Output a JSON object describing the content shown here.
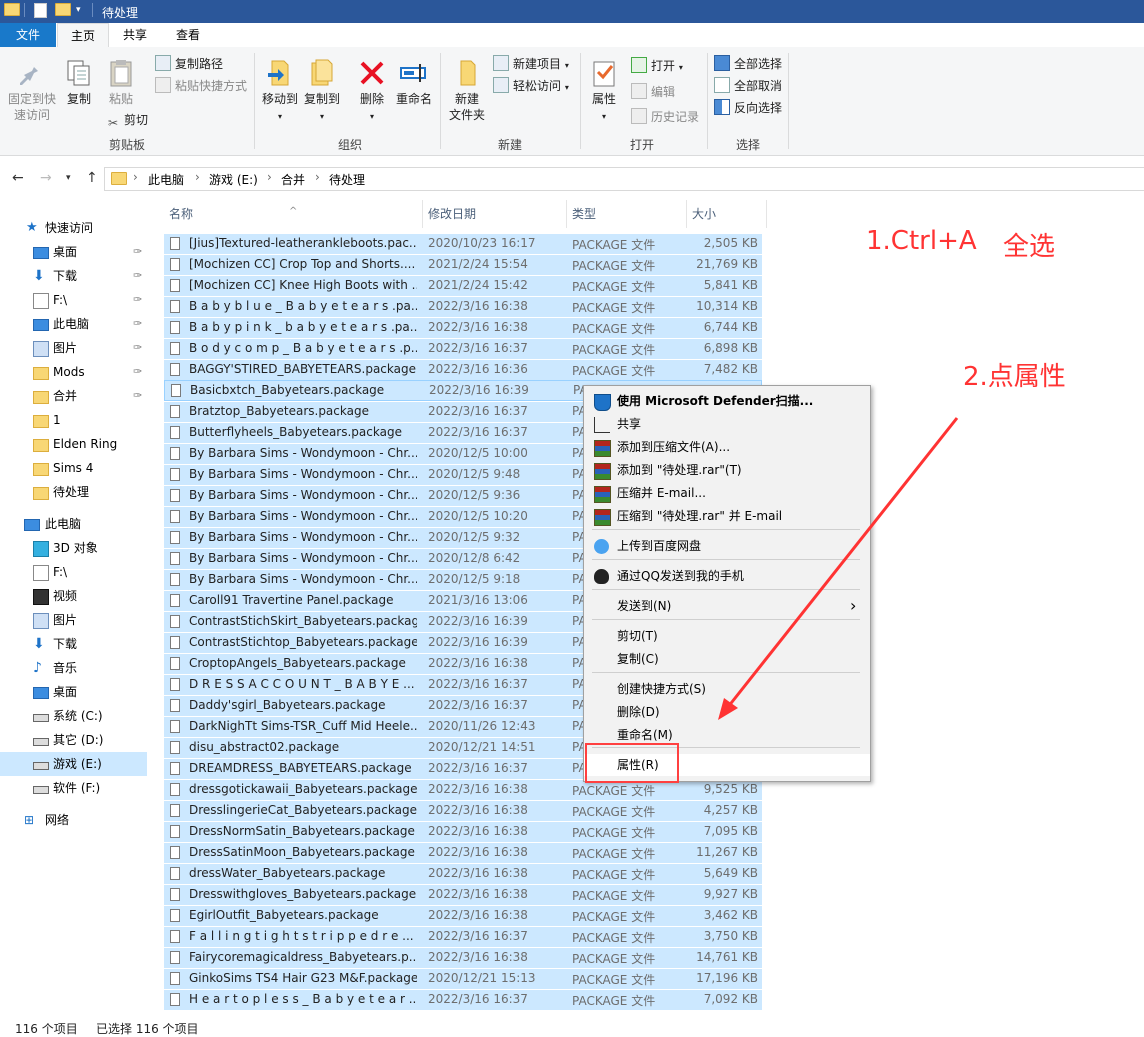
{
  "window": {
    "title": "待处理"
  },
  "ribbon_tabs": [
    {
      "label": "文件"
    },
    {
      "label": "主页"
    },
    {
      "label": "共享"
    },
    {
      "label": "查看"
    }
  ],
  "ribbon": {
    "pin": "固定到快速访问",
    "pin_line1": "固定到快",
    "pin_line2": "速访问",
    "copy": "复制",
    "paste": "粘贴",
    "copy_path": "复制路径",
    "paste_shortcut": "粘贴快捷方式",
    "cut": "剪切",
    "group_clipboard": "剪贴板",
    "move_to": "移动到",
    "copy_to": "复制到",
    "delete": "删除",
    "rename": "重命名",
    "group_organize": "组织",
    "new_folder_line1": "新建",
    "new_folder_line2": "文件夹",
    "new_item": "新建项目",
    "easy_access": "轻松访问",
    "group_new": "新建",
    "properties": "属性",
    "open": "打开",
    "edit": "编辑",
    "history": "历史记录",
    "group_open": "打开",
    "select_all": "全部选择",
    "select_none": "全部取消",
    "invert_selection": "反向选择",
    "group_select": "选择"
  },
  "address": {
    "crumbs": [
      "此电脑",
      "游戏 (E:)",
      "合并",
      "待处理"
    ]
  },
  "nav": {
    "quick_access": "快速访问",
    "items": [
      {
        "label": "桌面",
        "pinned": true
      },
      {
        "label": "下载",
        "pinned": true
      },
      {
        "label": "F:\\",
        "pinned": true
      },
      {
        "label": "此电脑",
        "pinned": true
      },
      {
        "label": "图片",
        "pinned": true
      },
      {
        "label": "Mods",
        "pinned": true
      },
      {
        "label": "合并",
        "pinned": true
      },
      {
        "label": "1",
        "pinned": false
      },
      {
        "label": "Elden Ring",
        "pinned": false
      },
      {
        "label": "Sims 4",
        "pinned": false
      },
      {
        "label": "待处理",
        "pinned": false
      }
    ],
    "this_pc": "此电脑",
    "pc_items": [
      {
        "label": "3D 对象"
      },
      {
        "label": "F:\\"
      },
      {
        "label": "视频"
      },
      {
        "label": "图片"
      },
      {
        "label": "下载"
      },
      {
        "label": "音乐"
      },
      {
        "label": "桌面"
      },
      {
        "label": "系统 (C:)"
      },
      {
        "label": "其它 (D:)"
      },
      {
        "label": "游戏 (E:)"
      },
      {
        "label": "软件 (F:)"
      }
    ],
    "network": "网络"
  },
  "columns": {
    "name": "名称",
    "date": "修改日期",
    "type": "类型",
    "size": "大小"
  },
  "files": [
    {
      "name": "[Jius]Textured-leatherankleboots.pac...",
      "date": "2020/10/23 16:17",
      "type": "PACKAGE 文件",
      "size": "2,505 KB"
    },
    {
      "name": "[Mochizen CC] Crop Top and Shorts....",
      "date": "2021/2/24 15:54",
      "type": "PACKAGE 文件",
      "size": "21,769 KB"
    },
    {
      "name": "[Mochizen CC] Knee High Boots with ...",
      "date": "2021/2/24 15:42",
      "type": "PACKAGE 文件",
      "size": "5,841 KB"
    },
    {
      "name": "B a b y b l u e _ B a b y e t e a r s .pa...",
      "date": "2022/3/16 16:38",
      "type": "PACKAGE 文件",
      "size": "10,314 KB"
    },
    {
      "name": "B a b y p i n k _ b a b y e t e a r s .pa...",
      "date": "2022/3/16 16:38",
      "type": "PACKAGE 文件",
      "size": "6,744 KB"
    },
    {
      "name": "B o d y c o m p _ B a b y e t e a r s .p...",
      "date": "2022/3/16 16:37",
      "type": "PACKAGE 文件",
      "size": "6,898 KB"
    },
    {
      "name": "BAGGY'STIRED_BABYETEARS.package",
      "date": "2022/3/16 16:36",
      "type": "PACKAGE 文件",
      "size": "7,482 KB"
    },
    {
      "name": "Basicbxtch_Babyetears.package",
      "date": "2022/3/16 16:39",
      "type": "PA",
      "size": ""
    },
    {
      "name": "Bratztop_Babyetears.package",
      "date": "2022/3/16 16:37",
      "type": "PA",
      "size": ""
    },
    {
      "name": "Butterflyheels_Babyetears.package",
      "date": "2022/3/16 16:37",
      "type": "PA",
      "size": ""
    },
    {
      "name": "By Barbara Sims - Wondymoon - Chr...",
      "date": "2020/12/5 10:00",
      "type": "PA",
      "size": ""
    },
    {
      "name": "By Barbara Sims - Wondymoon - Chr...",
      "date": "2020/12/5 9:48",
      "type": "PA",
      "size": ""
    },
    {
      "name": "By Barbara Sims - Wondymoon - Chr...",
      "date": "2020/12/5 9:36",
      "type": "PA",
      "size": ""
    },
    {
      "name": "By Barbara Sims - Wondymoon - Chr...",
      "date": "2020/12/5 10:20",
      "type": "PA",
      "size": ""
    },
    {
      "name": "By Barbara Sims - Wondymoon - Chr...",
      "date": "2020/12/5 9:32",
      "type": "PA",
      "size": ""
    },
    {
      "name": "By Barbara Sims - Wondymoon - Chr...",
      "date": "2020/12/8 6:42",
      "type": "PA",
      "size": ""
    },
    {
      "name": "By Barbara Sims - Wondymoon - Chr...",
      "date": "2020/12/5 9:18",
      "type": "PA",
      "size": ""
    },
    {
      "name": "Caroll91 Travertine Panel.package",
      "date": "2021/3/16 13:06",
      "type": "PA",
      "size": ""
    },
    {
      "name": "ContrastStichSkirt_Babyetears.package",
      "date": "2022/3/16 16:39",
      "type": "PA",
      "size": ""
    },
    {
      "name": "ContrastStichtop_Babyetears.package",
      "date": "2022/3/16 16:39",
      "type": "PA",
      "size": ""
    },
    {
      "name": "CroptopAngels_Babyetears.package",
      "date": "2022/3/16 16:38",
      "type": "PA",
      "size": ""
    },
    {
      "name": "D R E S S A C C O U N T _ B A B Y E ...",
      "date": "2022/3/16 16:37",
      "type": "PA",
      "size": ""
    },
    {
      "name": "Daddy'sgirl_Babyetears.package",
      "date": "2022/3/16 16:37",
      "type": "PA",
      "size": ""
    },
    {
      "name": "DarkNighTt Sims-TSR_Cuff Mid Heele...",
      "date": "2020/11/26 12:43",
      "type": "PA",
      "size": ""
    },
    {
      "name": "disu_abstract02.package",
      "date": "2020/12/21 14:51",
      "type": "PA",
      "size": ""
    },
    {
      "name": "DREAMDRESS_BABYETEARS.package",
      "date": "2022/3/16 16:37",
      "type": "PA",
      "size": ""
    },
    {
      "name": "dressgotickawaii_Babyetears.package",
      "date": "2022/3/16 16:38",
      "type": "PACKAGE 文件",
      "size": "9,525 KB"
    },
    {
      "name": "DresslingerieCat_Babyetears.package",
      "date": "2022/3/16 16:38",
      "type": "PACKAGE 文件",
      "size": "4,257 KB"
    },
    {
      "name": "DressNormSatin_Babyetears.package",
      "date": "2022/3/16 16:38",
      "type": "PACKAGE 文件",
      "size": "7,095 KB"
    },
    {
      "name": "DressSatinMoon_Babyetears.package",
      "date": "2022/3/16 16:38",
      "type": "PACKAGE 文件",
      "size": "11,267 KB"
    },
    {
      "name": "dressWater_Babyetears.package",
      "date": "2022/3/16 16:38",
      "type": "PACKAGE 文件",
      "size": "5,649 KB"
    },
    {
      "name": "Dresswithgloves_Babyetears.package",
      "date": "2022/3/16 16:38",
      "type": "PACKAGE 文件",
      "size": "9,927 KB"
    },
    {
      "name": "EgirlOutfit_Babyetears.package",
      "date": "2022/3/16 16:38",
      "type": "PACKAGE 文件",
      "size": "3,462 KB"
    },
    {
      "name": "F a l l i n g t i g h t s t r i p p e d r e ...",
      "date": "2022/3/16 16:37",
      "type": "PACKAGE 文件",
      "size": "3,750 KB"
    },
    {
      "name": "Fairycoremagicaldress_Babyetears.p...",
      "date": "2022/3/16 16:38",
      "type": "PACKAGE 文件",
      "size": "14,761 KB"
    },
    {
      "name": "GinkoSims TS4 Hair G23 M&F.package",
      "date": "2020/12/21 15:13",
      "type": "PACKAGE 文件",
      "size": "17,196 KB"
    },
    {
      "name": "H e a r t o p l e s s _ B a b y e t e a r ...",
      "date": "2022/3/16 16:37",
      "type": "PACKAGE 文件",
      "size": "7,092 KB"
    }
  ],
  "context_menu": [
    {
      "label": "使用 Microsoft Defender扫描...",
      "icon": "defender-shield-icon",
      "bold": true
    },
    {
      "label": "共享",
      "icon": "share-icon"
    },
    {
      "label": "添加到压缩文件(A)...",
      "icon": "winrar-icon"
    },
    {
      "label": "添加到 \"待处理.rar\"(T)",
      "icon": "winrar-icon"
    },
    {
      "label": "压缩并 E-mail...",
      "icon": "winrar-icon"
    },
    {
      "label": "压缩到 \"待处理.rar\" 并 E-mail",
      "icon": "winrar-icon"
    },
    {
      "label": "上传到百度网盘",
      "icon": "baidu-netdisk-icon"
    },
    {
      "label": "通过QQ发送到我的手机",
      "icon": "qq-icon"
    },
    {
      "label": "发送到(N)",
      "icon": "",
      "submenu": true
    },
    {
      "label": "剪切(T)",
      "icon": ""
    },
    {
      "label": "复制(C)",
      "icon": ""
    },
    {
      "label": "创建快捷方式(S)",
      "icon": ""
    },
    {
      "label": "删除(D)",
      "icon": ""
    },
    {
      "label": "重命名(M)",
      "icon": ""
    },
    {
      "label": "属性(R)",
      "icon": ""
    }
  ],
  "status": {
    "count": "116 个项目",
    "selected": "已选择 116 个项目"
  },
  "annotations": {
    "step1": "1.Ctrl+A",
    "step1b": "全选",
    "step2": "2.点属性",
    "color": "#ff3333"
  }
}
